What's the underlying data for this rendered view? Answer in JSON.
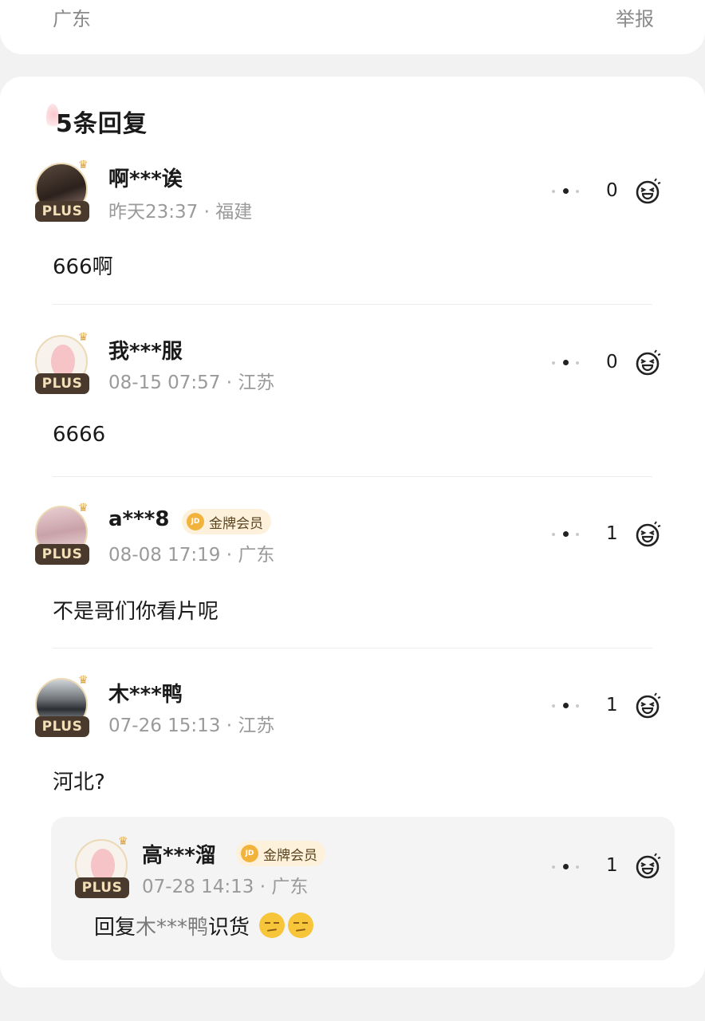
{
  "top": {
    "region": "广东",
    "report": "举报"
  },
  "section": {
    "title": "5条回复"
  },
  "comments": [
    {
      "user": "啊***诶",
      "plus": "PLUS",
      "time": "昨天23:37 · 福建",
      "text": "666啊",
      "likes": "0"
    },
    {
      "user": "我***服",
      "plus": "PLUS",
      "time": "08-15 07:57 · 江苏",
      "text": "6666",
      "likes": "0"
    },
    {
      "user": "a***8",
      "plus": "PLUS",
      "badge": "金牌会员",
      "time": "08-08 17:19 · 广东",
      "text": "不是哥们你看片呢",
      "likes": "1"
    },
    {
      "user": "木***鸭",
      "plus": "PLUS",
      "time": "07-26 15:13 · 江苏",
      "text": "河北?",
      "likes": "1"
    }
  ],
  "reply": {
    "user": "高***溜",
    "plus": "PLUS",
    "badge": "金牌会员",
    "time": "07-28 14:13 · 广东",
    "prefix": "回复",
    "mention": "木***鸭",
    "text": "识货",
    "likes": "1"
  },
  "badge_coin_text": "JD",
  "colors": {
    "plus_bg": "#4a3a2d",
    "plus_text": "#f3dfb8",
    "badge_bg": "#fdf1dc",
    "coin": "#f2b33d"
  },
  "icons": {
    "crown": "crown-icon",
    "like": "laugh-emoji-icon",
    "more": "more-dots-icon",
    "emoji": "smirk-emoji-icon"
  }
}
